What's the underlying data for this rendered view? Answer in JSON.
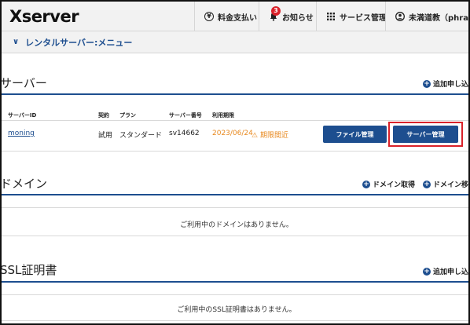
{
  "header": {
    "logo": "Xserver",
    "items": [
      {
        "label": "料金支払い",
        "icon": "coin-icon"
      },
      {
        "label": "お知らせ",
        "icon": "bell-icon",
        "badge": "3"
      },
      {
        "label": "サービス管理",
        "icon": "grid-icon"
      },
      {
        "label": "未満道教（phra...",
        "icon": "person-icon"
      }
    ]
  },
  "menu": {
    "label": "レンタルサーバー:メニュー"
  },
  "server_section": {
    "title": "サーバー",
    "add_label": "追加申し込",
    "columns": [
      "サーバーID",
      "契約",
      "プラン",
      "サーバー番号",
      "利用期限"
    ],
    "row": {
      "server_id": "moning",
      "contract": "試用",
      "plan": "スタンダード",
      "server_no": "sv14662",
      "expiry": "2023/06/24",
      "warning": "期限間近"
    },
    "file_button": "ファイル管理",
    "server_button": "サーバー管理"
  },
  "domain_section": {
    "title": "ドメイン",
    "acquire_label": "ドメイン取得",
    "transfer_label": "ドメイン移",
    "empty": "ご利用中のドメインはありません。"
  },
  "ssl_section": {
    "title": "SSL証明書",
    "add_label": "追加申し込",
    "empty": "ご利用中のSSL証明書はありません。"
  },
  "colors": {
    "accent": "#1d4e8f",
    "warning": "#e8891f",
    "highlight": "#d9222a"
  }
}
